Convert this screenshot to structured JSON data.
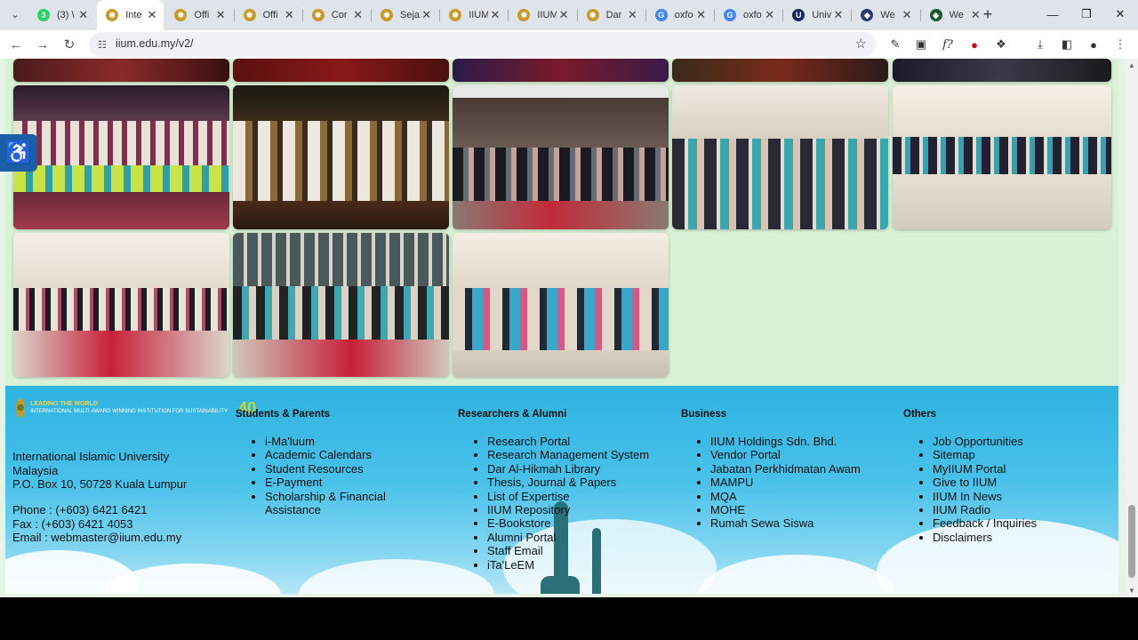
{
  "browser": {
    "tabs": [
      {
        "title": "(3) \\",
        "color": "#25d366",
        "glyph": "3"
      },
      {
        "title": "Inte",
        "color": "#c79a2b",
        "glyph": "✹"
      },
      {
        "title": "Offi",
        "color": "#c79a2b",
        "glyph": "✹"
      },
      {
        "title": "Offi",
        "color": "#c79a2b",
        "glyph": "✹"
      },
      {
        "title": "Cor",
        "color": "#c79a2b",
        "glyph": "✹"
      },
      {
        "title": "Seja",
        "color": "#c79a2b",
        "glyph": "✹"
      },
      {
        "title": "IIUM",
        "color": "#c79a2b",
        "glyph": "✹"
      },
      {
        "title": "IIUM",
        "color": "#c79a2b",
        "glyph": "✹"
      },
      {
        "title": "Dar",
        "color": "#c79a2b",
        "glyph": "✹"
      },
      {
        "title": "oxfo",
        "color": "#4285f4",
        "glyph": "G"
      },
      {
        "title": "oxfo",
        "color": "#4285f4",
        "glyph": "G"
      },
      {
        "title": "Univ",
        "color": "#1b2a5a",
        "glyph": "U"
      },
      {
        "title": "We",
        "color": "#2b3c6e",
        "glyph": "◆"
      },
      {
        "title": "We",
        "color": "#1e5a2f",
        "glyph": "◆"
      }
    ],
    "url": "iium.edu.my/v2/"
  },
  "footer": {
    "logo": {
      "line1": "LEADING THE WORLD",
      "line2": "INTERNATIONAL MULTI-AWARD WINNING INSTITUTION FOR SUSTAINABILITY",
      "badge": "40"
    },
    "address": [
      "International Islamic University",
      "Malaysia",
      "P.O. Box 10, 50728 Kuala Lumpur"
    ],
    "phone": "Phone : (+603) 6421 6421",
    "fax": "Fax : (+603) 6421 4053",
    "email": "Email : webmaster@iium.edu.my",
    "columns": [
      {
        "heading": "Students & Parents",
        "items": [
          "i-Ma'luum",
          "Academic Calendars",
          "Student Resources",
          "E-Payment",
          "Scholarship & Financial Assistance"
        ]
      },
      {
        "heading": "Researchers & Alumni",
        "items": [
          "Research Portal",
          "Research Management System",
          "Dar Al-Hikmah Library",
          "Thesis, Journal & Papers",
          "List of Expertise",
          "IIUM Repository",
          "E-Bookstore",
          "Alumni Portal",
          "Staff Email",
          "iTa'LeEM"
        ]
      },
      {
        "heading": "Business",
        "items": [
          "IIUM Holdings Sdn. Bhd.",
          "Vendor Portal",
          "Jabatan Perkhidmatan Awam",
          "MAMPU",
          "MQA",
          "MOHE",
          "Rumah Sewa Siswa"
        ]
      },
      {
        "heading": "Others",
        "items": [
          "Job Opportunities",
          "Sitemap",
          "MyIIUM Portal",
          "Give to IIUM",
          "IIUM In News",
          "IIUM Radio",
          "Feedback / Inquiries",
          "Disclaimers"
        ]
      }
    ]
  }
}
